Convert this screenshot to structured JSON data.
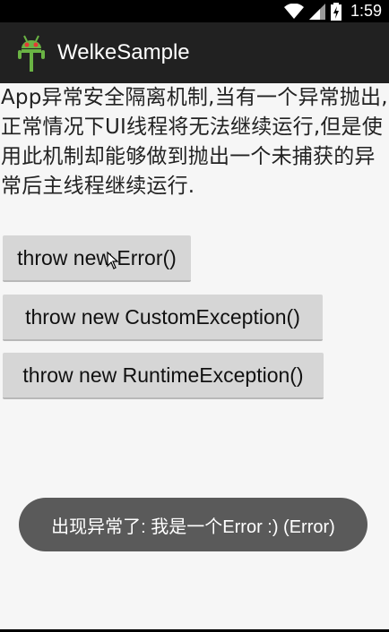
{
  "status_bar": {
    "time": "1:59",
    "icons": [
      "wifi-icon",
      "signal-icon",
      "battery-charging-icon"
    ]
  },
  "action_bar": {
    "app_icon": "android-robot-icon",
    "title": "WelkeSample"
  },
  "main": {
    "description": "App异常安全隔离机制,当有一个异常抛出,正常情况下UI线程将无法继续运行,但是使用此机制却能够做到抛出一个未捕获的异常后主线程继续运行.",
    "buttons": [
      {
        "label": "throw new Error()"
      },
      {
        "label": "throw new CustomException()"
      },
      {
        "label": "throw new RuntimeException()"
      }
    ]
  },
  "toast": {
    "message": "出现异常了: 我是一个Error :) (Error)"
  },
  "colors": {
    "action_bar": "#212121",
    "status_bar": "#000000",
    "button": "#d6d6d6",
    "toast": "#5a5a5a",
    "icon_green": "#6ab344"
  }
}
